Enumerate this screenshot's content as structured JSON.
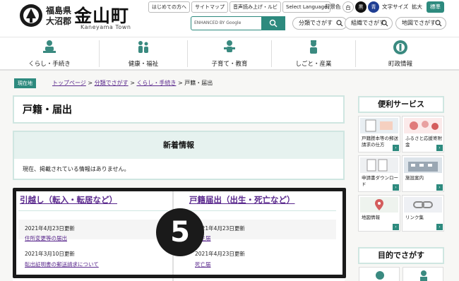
{
  "header": {
    "pref": "福島県",
    "gun": "大沼郡",
    "town": "金山町",
    "town_en": "Kaneyama Town",
    "util_links": [
      "はじめての方へ",
      "サイトマップ",
      "音声読み上げ・ルビ",
      "Select Language"
    ],
    "color_label": "背景色",
    "color_white": "白",
    "color_black": "黒",
    "color_blue": "青",
    "size_label": "文字サイズ",
    "size_big": "拡大",
    "size_std": "標準",
    "search_placeholder": "ENHANCED BY Google",
    "find_buttons": [
      "分類でさがす",
      "組織でさがす",
      "地図でさがす"
    ]
  },
  "gnav": [
    "くらし・手続き",
    "健康・福祉",
    "子育て・教育",
    "しごと・産業",
    "町政情報"
  ],
  "breadcrumb": {
    "here": "現在地",
    "items": [
      "トップページ",
      "分類でさがす",
      "くらし・手続き"
    ],
    "sep": ">",
    "current": "戸籍・届出"
  },
  "page_title": "戸籍・届出",
  "news": {
    "heading": "新着情報",
    "empty": "現在、掲載されている情報はありません。"
  },
  "cards": [
    {
      "title": "引越し（転入・転居など）",
      "entries": [
        {
          "date": "2021年4月23日更新",
          "link": "住所変更等の届出"
        },
        {
          "date": "2021年3月10日更新",
          "link": "転出証明書の郵送請求について"
        }
      ]
    },
    {
      "title": "戸籍届出（出生・死亡など）",
      "entries": [
        {
          "date": "2021年4月23日更新",
          "link": "出生届"
        },
        {
          "date": "2021年4月23日更新",
          "link": "死亡届"
        }
      ]
    }
  ],
  "badge": "5",
  "sidebar": {
    "services_heading": "便利サービス",
    "services": [
      {
        "label": "戸籍謄本等の郵送請求の仕方"
      },
      {
        "label": "ふるさと応援寄附金"
      },
      {
        "label": "申請書ダウンロード"
      },
      {
        "label": "施設案内"
      },
      {
        "label": "地図情報"
      },
      {
        "label": "リンク集"
      }
    ],
    "purpose_heading": "目的でさがす"
  }
}
